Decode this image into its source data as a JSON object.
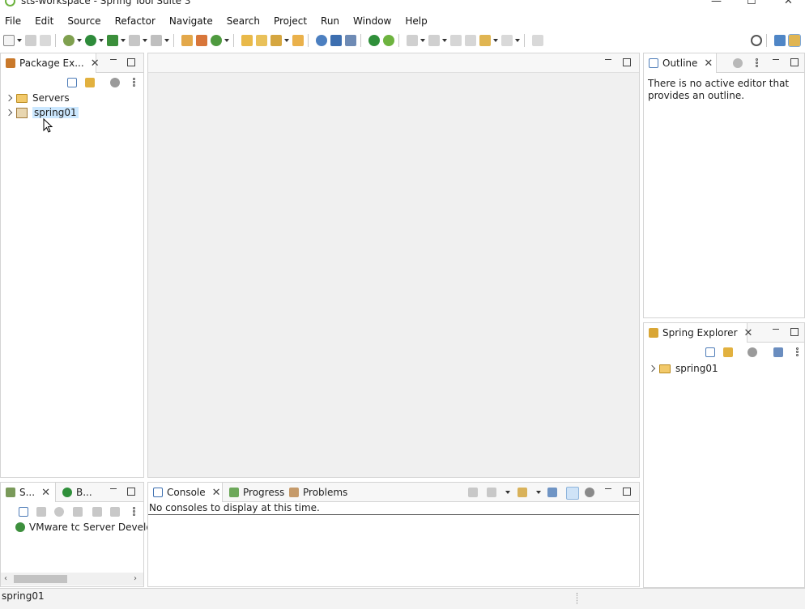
{
  "window": {
    "title": "sts-workspace - Spring Tool Suite 3"
  },
  "menu": [
    "File",
    "Edit",
    "Source",
    "Refactor",
    "Navigate",
    "Search",
    "Project",
    "Run",
    "Window",
    "Help"
  ],
  "package_explorer": {
    "tab_label": "Package Ex...",
    "items": [
      {
        "label": "Servers",
        "icon": "folder-icon"
      },
      {
        "label": "spring01",
        "icon": "project-icon"
      }
    ]
  },
  "outline": {
    "tab_label": "Outline",
    "message": "There is no active editor that provides an outline."
  },
  "spring_explorer": {
    "tab_label": "Spring Explorer",
    "items": [
      {
        "label": "spring01",
        "icon": "folder-icon"
      }
    ]
  },
  "servers_panel": {
    "tabs": [
      {
        "label": "S..."
      },
      {
        "label": "B..."
      }
    ],
    "items": [
      {
        "label": "VMware tc Server Develop"
      }
    ]
  },
  "console_panel": {
    "tabs": [
      {
        "label": "Console"
      },
      {
        "label": "Progress"
      },
      {
        "label": "Problems"
      }
    ],
    "message": "No consoles to display at this time."
  },
  "status": {
    "text": "spring01"
  },
  "colors": {
    "spring_green": "#6db33f",
    "selection": "#cce8ff",
    "border": "#d4d4d4"
  }
}
